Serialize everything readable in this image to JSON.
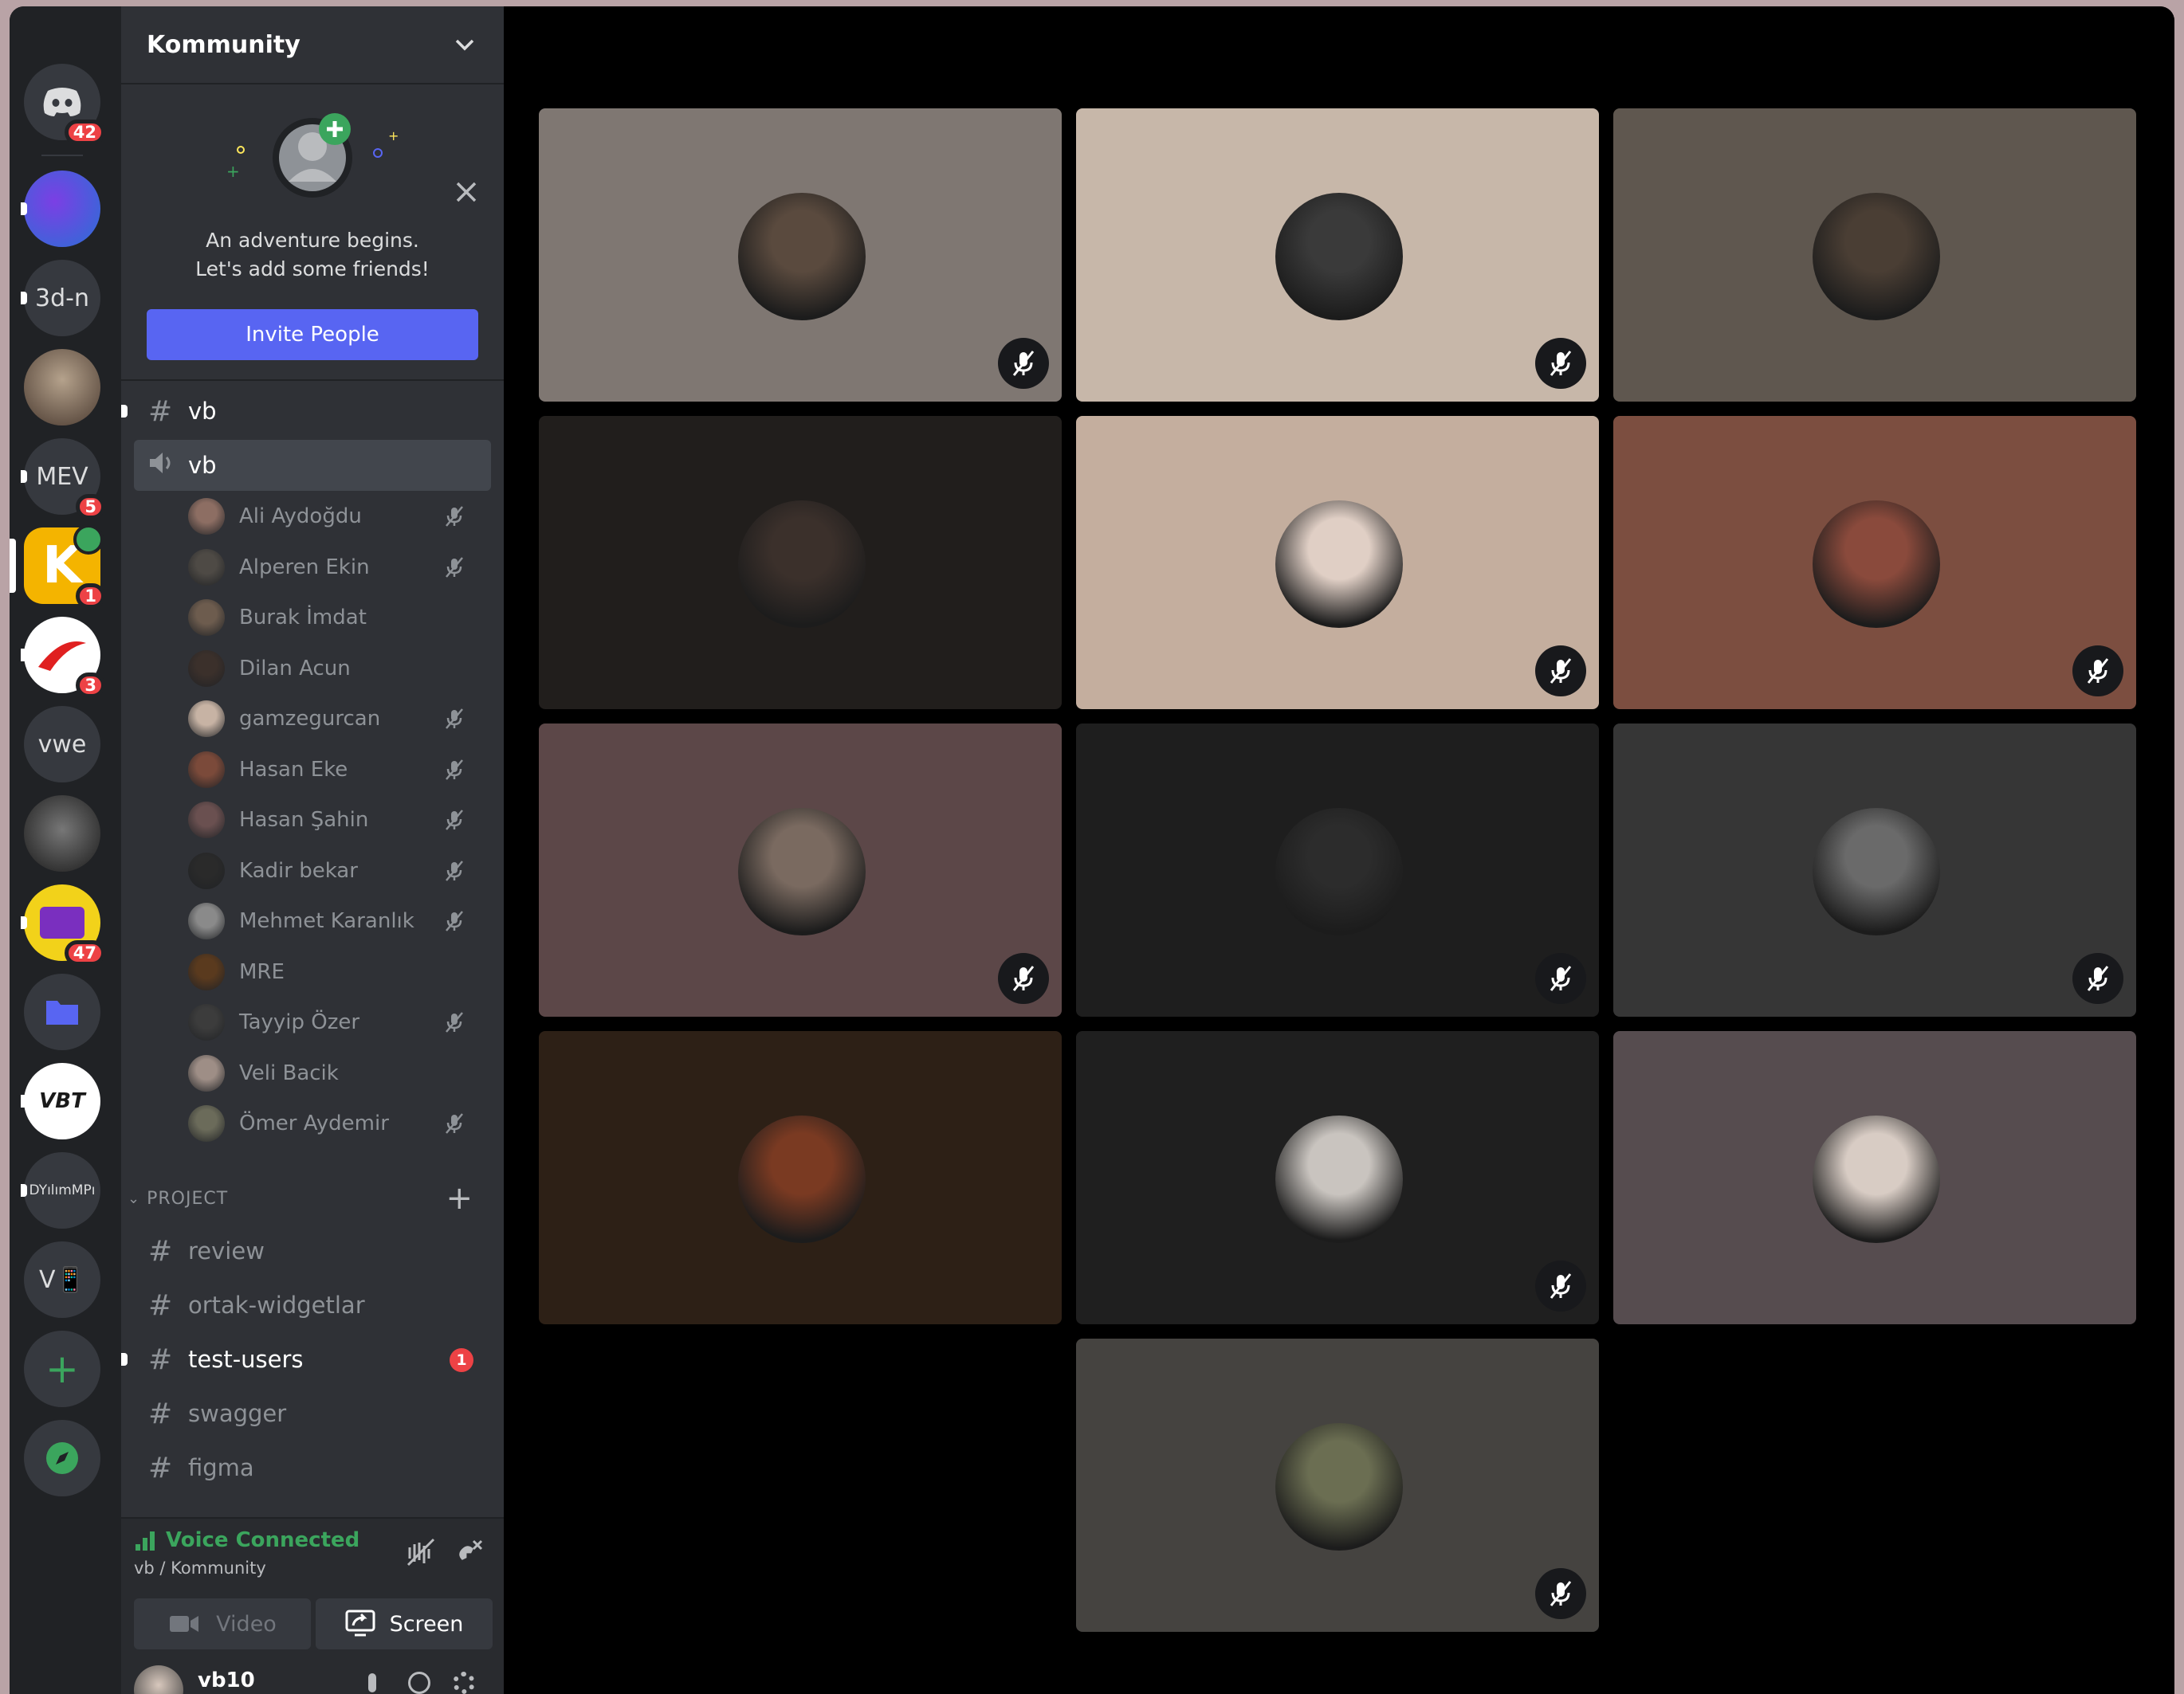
{
  "server": {
    "name": "Kommunity"
  },
  "rail": {
    "dm_badge": "42",
    "servers": [
      {
        "label": "3d-n"
      },
      {
        "label": "MEV",
        "badge": "5"
      },
      {
        "label": "",
        "badge": "1"
      },
      {
        "label": "",
        "badge": "3"
      },
      {
        "label": "vwe"
      },
      {
        "label": "",
        "badge": "47"
      },
      {
        "label": "VBT"
      },
      {
        "label": "DYılımMPı"
      },
      {
        "label": "V📱"
      }
    ]
  },
  "welcome": {
    "line1": "An adventure begins.",
    "line2": "Let's add some friends!",
    "invite_label": "Invite People"
  },
  "channels": {
    "text_top": "vb",
    "voice": "vb",
    "members": [
      {
        "name": "Ali Aydoğdu",
        "muted": true,
        "color": "#8d6e63"
      },
      {
        "name": "Alperen Ekin",
        "muted": true,
        "color": "#4e4a45"
      },
      {
        "name": "Burak İmdat",
        "muted": false,
        "color": "#6d5c4e"
      },
      {
        "name": "Dilan Acun",
        "muted": false,
        "color": "#3b302b"
      },
      {
        "name": "gamzegurcan",
        "muted": true,
        "color": "#c7b3a4"
      },
      {
        "name": "Hasan Eke",
        "muted": true,
        "color": "#7b4a3a"
      },
      {
        "name": "Hasan Şahin",
        "muted": true,
        "color": "#6a5050"
      },
      {
        "name": "Kadir bekar",
        "muted": true,
        "color": "#2a2a2a"
      },
      {
        "name": "Mehmet Karanlık",
        "muted": true,
        "color": "#8a8a8a"
      },
      {
        "name": "MRE",
        "muted": false,
        "color": "#5a3a1e"
      },
      {
        "name": "Tayyip Özer",
        "muted": true,
        "color": "#3c3c3c"
      },
      {
        "name": "Veli Bacik",
        "muted": false,
        "color": "#9e8e86"
      },
      {
        "name": "Ömer Aydemir",
        "muted": true,
        "color": "#6b6b5a"
      }
    ],
    "category": "PROJECT",
    "project_channels": [
      {
        "name": "review",
        "unread": ""
      },
      {
        "name": "ortak-widgetlar",
        "unread": ""
      },
      {
        "name": "test-users",
        "unread": "1"
      },
      {
        "name": "swagger",
        "unread": ""
      },
      {
        "name": "figma",
        "unread": ""
      }
    ]
  },
  "voice_status": {
    "title": "Voice Connected",
    "subtitle": "vb / Kommunity",
    "video_label": "Video",
    "screen_label": "Screen"
  },
  "user": {
    "name": "vb10"
  },
  "colors": {
    "accent": "#5865f2",
    "connected": "#3ba55d",
    "badge": "#ed4245"
  },
  "tiles": [
    {
      "bg": "#7f7772",
      "face": "#5a4a3e",
      "muted": true
    },
    {
      "bg": "#c7b7a9",
      "face": "#3a3a3a",
      "muted": true
    },
    {
      "bg": "#5f574f",
      "face": "#4a3e34",
      "muted": false
    },
    {
      "bg": "#211e1c",
      "face": "#3b302b",
      "muted": false
    },
    {
      "bg": "#c4ae9e",
      "face": "#e0cfc5",
      "muted": true
    },
    {
      "bg": "#7c4e40",
      "face": "#8a4a3c",
      "muted": true
    },
    {
      "bg": "#5c4748",
      "face": "#7a6a60",
      "muted": true
    },
    {
      "bg": "#1e1e1e",
      "face": "#2c2c2c",
      "muted": true
    },
    {
      "bg": "#363636",
      "face": "#6a6a6a",
      "muted": true
    },
    {
      "bg": "#2d2016",
      "face": "#7a3a22",
      "muted": false
    },
    {
      "bg": "#1f1f1f",
      "face": "#c9c4bf",
      "muted": true
    },
    {
      "bg": "#564c4f",
      "face": "#d8ccc4",
      "muted": false
    },
    {
      "bg": "#454340",
      "face": "#6b6e52",
      "muted": true
    }
  ]
}
